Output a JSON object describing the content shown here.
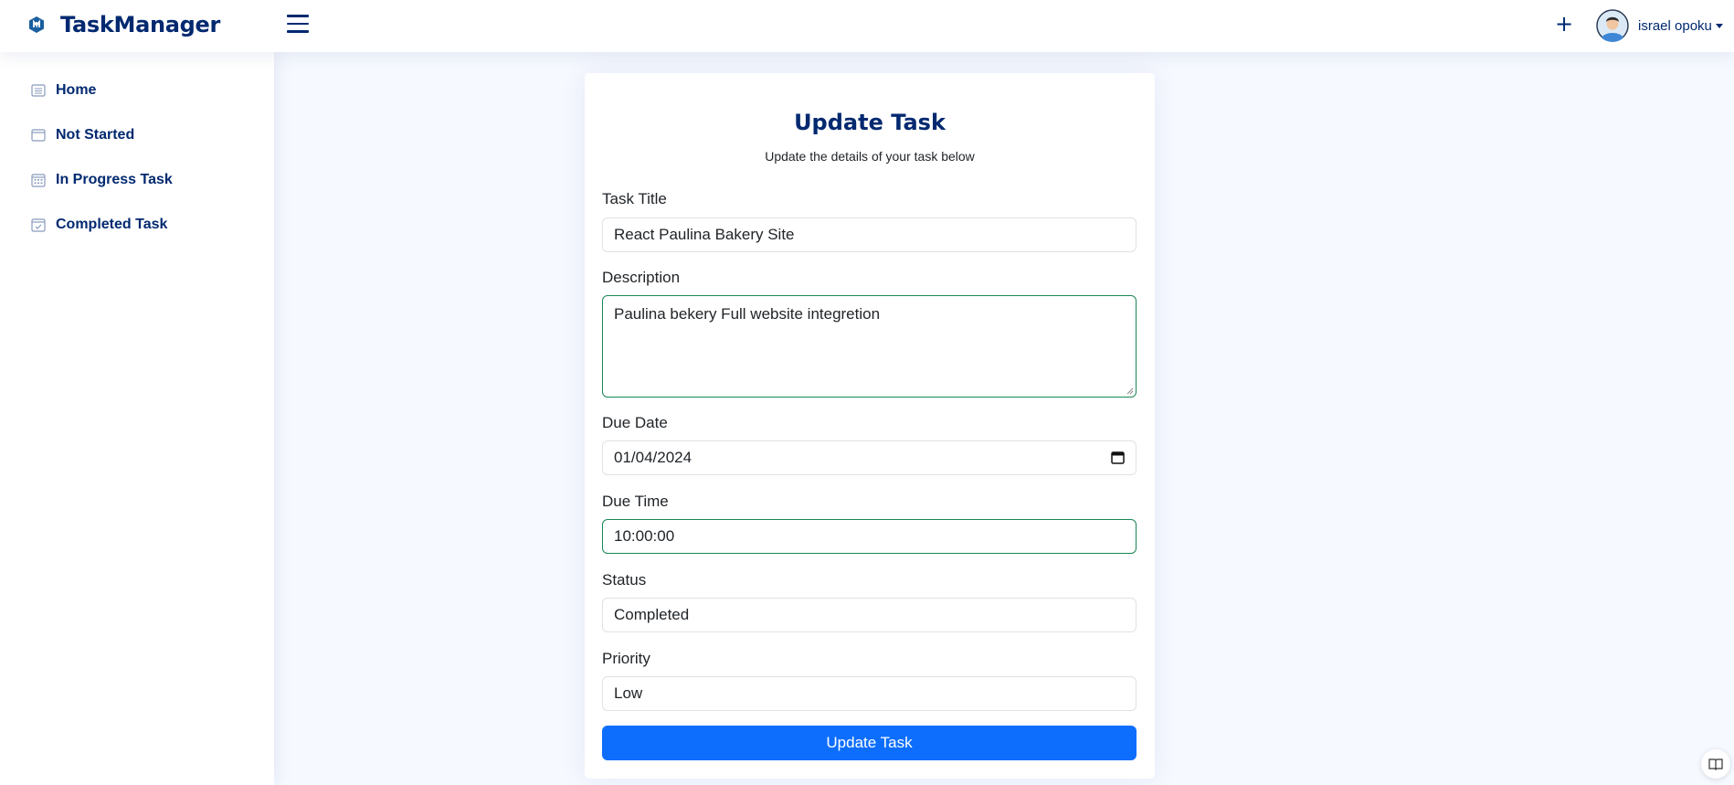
{
  "header": {
    "brand": "TaskManager",
    "add_label": "+",
    "user_name": "israel opoku"
  },
  "sidebar": {
    "items": [
      {
        "label": "Home",
        "icon": "list-icon"
      },
      {
        "label": "Not Started",
        "icon": "window-icon"
      },
      {
        "label": "In Progress Task",
        "icon": "calendar-grid-icon"
      },
      {
        "label": "Completed Task",
        "icon": "calendar-check-icon"
      }
    ]
  },
  "form": {
    "title": "Update Task",
    "subtitle": "Update the details of your task below",
    "task_title_label": "Task Title",
    "task_title_value": "React Paulina Bakery Site",
    "description_label": "Description",
    "description_value": "Paulina bekery Full website integretion",
    "due_date_label": "Due Date",
    "due_date_value": "01/04/2024",
    "due_time_label": "Due Time",
    "due_time_value": "10:00:00",
    "status_label": "Status",
    "status_value": "Completed",
    "priority_label": "Priority",
    "priority_value": "Low",
    "submit_label": "Update Task"
  },
  "colors": {
    "brand": "#012970",
    "primary_button": "#0d6efd",
    "valid_border": "#198754",
    "background": "#f6f9ff"
  }
}
